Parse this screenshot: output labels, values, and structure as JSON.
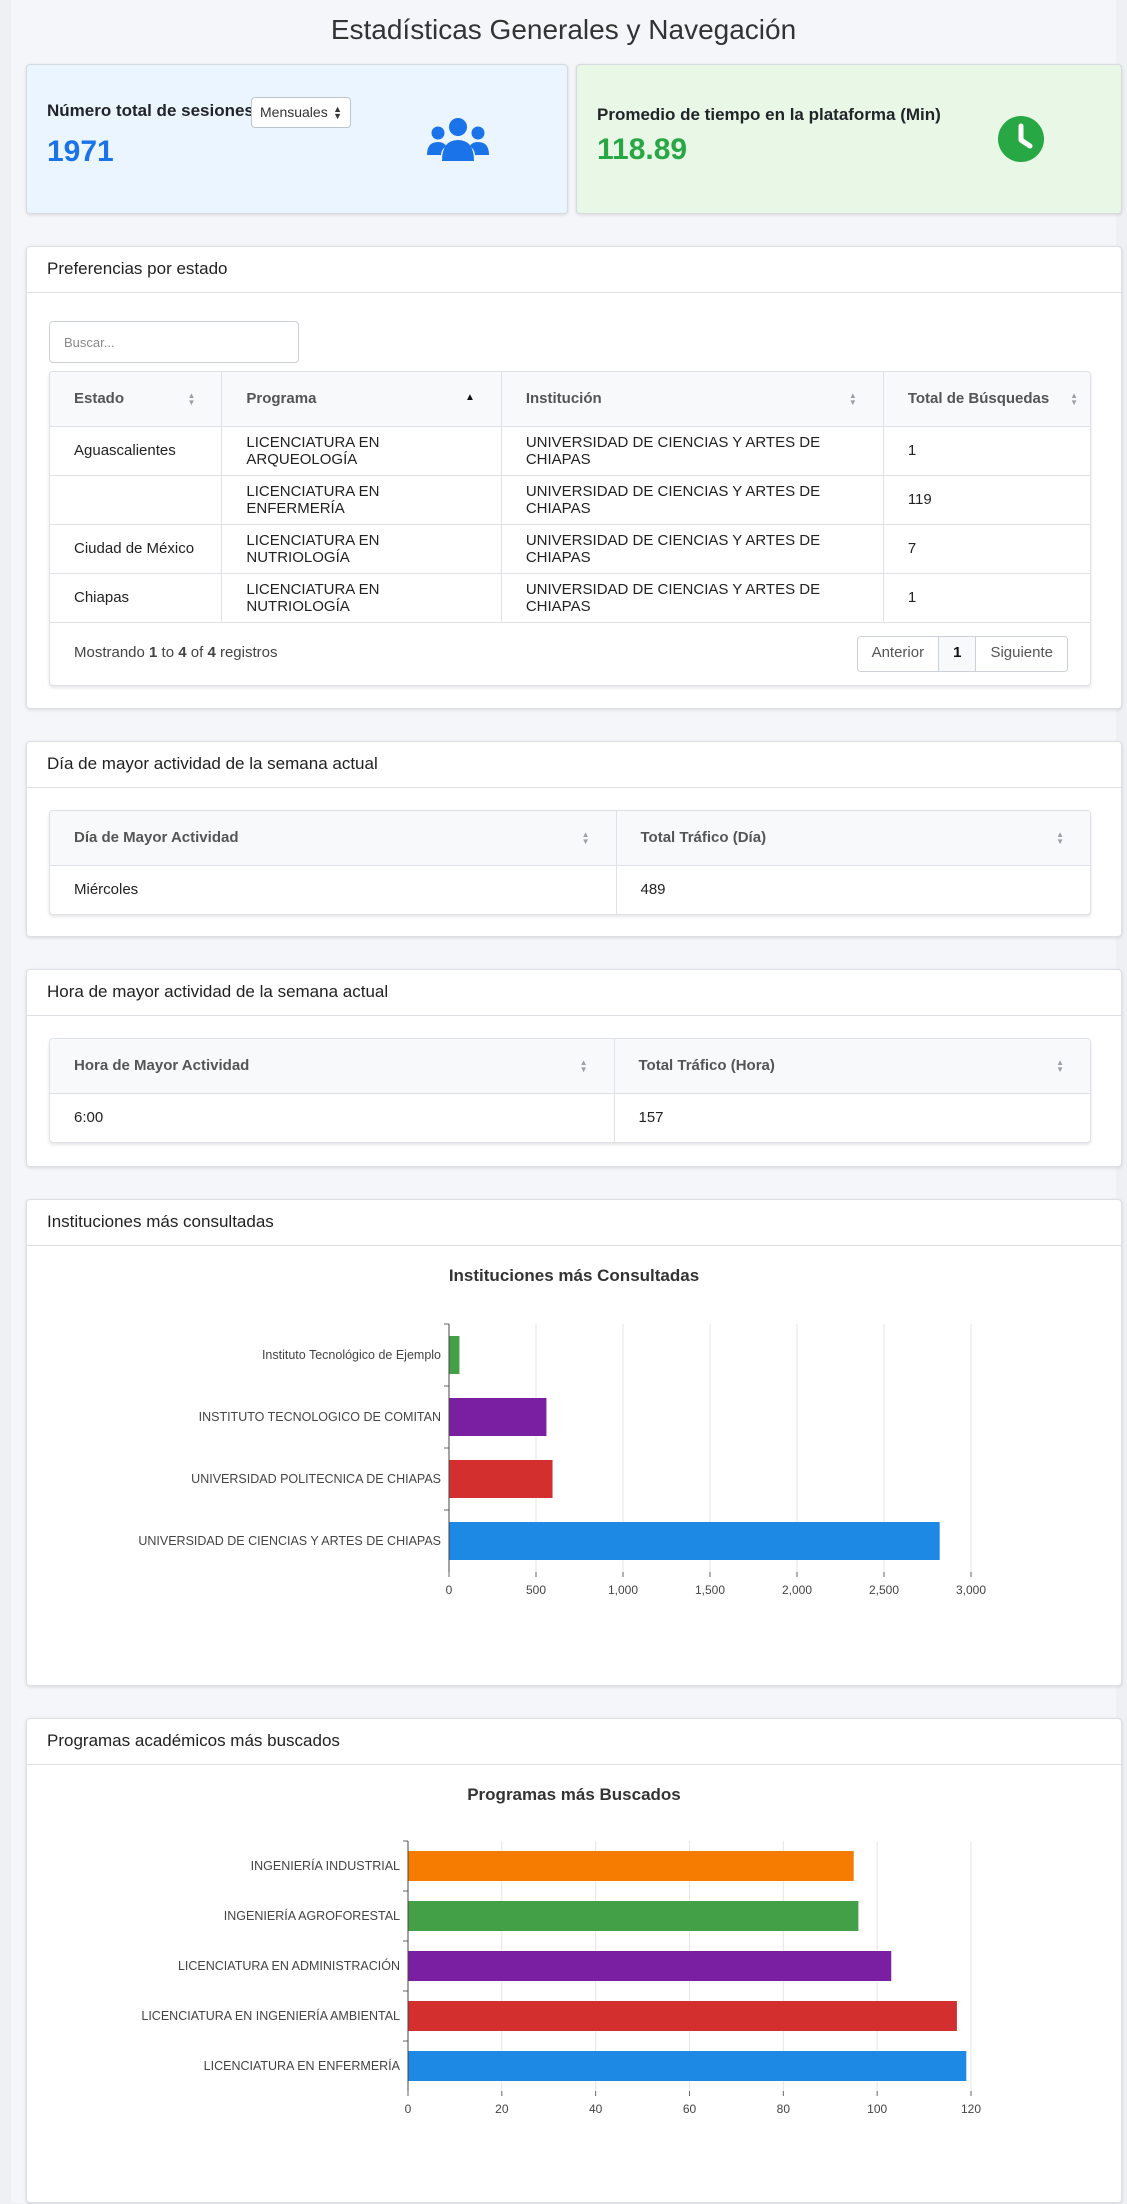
{
  "page": {
    "title": "Estadísticas Generales y Navegación"
  },
  "sessions_card": {
    "label": "Número total de sesiones",
    "select_value": "Mensuales",
    "value": "1971",
    "icon": "users-icon",
    "accent": "#1a73e8"
  },
  "time_card": {
    "label": "Promedio de tiempo en la plataforma (Min)",
    "value": "118.89",
    "icon": "clock-icon",
    "accent": "#28a745"
  },
  "preferences": {
    "title": "Preferencias por estado",
    "search_placeholder": "Buscar...",
    "columns": [
      "Estado",
      "Programa",
      "Institución",
      "Total de Búsquedas"
    ],
    "rows": [
      [
        "Aguascalientes",
        "LICENCIATURA EN ARQUEOLOGÍA",
        "UNIVERSIDAD DE CIENCIAS Y ARTES DE CHIAPAS",
        "1"
      ],
      [
        "",
        "LICENCIATURA EN ENFERMERÍA",
        "UNIVERSIDAD DE CIENCIAS Y ARTES DE CHIAPAS",
        "119"
      ],
      [
        "Ciudad de México",
        "LICENCIATURA EN NUTRIOLOGÍA",
        "UNIVERSIDAD DE CIENCIAS Y ARTES DE CHIAPAS",
        "7"
      ],
      [
        "Chiapas",
        "LICENCIATURA EN NUTRIOLOGÍA",
        "UNIVERSIDAD DE CIENCIAS Y ARTES DE CHIAPAS",
        "1"
      ]
    ],
    "info": {
      "prefix": "Mostrando ",
      "from": "1",
      "to_word": " to ",
      "to": "4",
      "of_word": " of ",
      "total": "4",
      "suffix": " registros"
    },
    "pager": {
      "prev": "Anterior",
      "current": "1",
      "next": "Siguiente"
    }
  },
  "day_activity": {
    "title": "Día de mayor actividad de la semana actual",
    "columns": [
      "Día de Mayor Actividad",
      "Total Tráfico (Día)"
    ],
    "rows": [
      [
        "Miércoles",
        "489"
      ]
    ]
  },
  "hour_activity": {
    "title": "Hora de mayor actividad de la semana actual",
    "columns": [
      "Hora de Mayor Actividad",
      "Total Tráfico (Hora)"
    ],
    "rows": [
      [
        "6:00",
        "157"
      ]
    ]
  },
  "institutions_card": {
    "title": "Instituciones más consultadas"
  },
  "programs_card": {
    "title": "Programas académicos más buscados"
  },
  "chart_data": [
    {
      "type": "bar",
      "orientation": "horizontal",
      "title": "Instituciones más Consultadas",
      "categories": [
        "Instituto Tecnológico de Ejemplo",
        "INSTITUTO TECNOLOGICO DE COMITAN",
        "UNIVERSIDAD POLITECNICA DE CHIAPAS",
        "UNIVERSIDAD DE CIENCIAS Y ARTES DE CHIAPAS"
      ],
      "values": [
        60,
        560,
        595,
        2820
      ],
      "colors": [
        "#43a047",
        "#7b1fa2",
        "#d32f2f",
        "#1e88e5"
      ],
      "xlim": [
        0,
        3000
      ],
      "ticks": [
        "0",
        "500",
        "1,000",
        "1,500",
        "2,000",
        "2,500",
        "3,000"
      ],
      "grid": true
    },
    {
      "type": "bar",
      "orientation": "horizontal",
      "title": "Programas más Buscados",
      "categories": [
        "INGENIERÍA INDUSTRIAL",
        "INGENIERÍA AGROFORESTAL",
        "LICENCIATURA EN ADMINISTRACIÓN",
        "LICENCIATURA EN INGENIERÍA AMBIENTAL",
        "LICENCIATURA EN ENFERMERÍA"
      ],
      "values": [
        95,
        96,
        103,
        117,
        119
      ],
      "colors": [
        "#f57c00",
        "#43a047",
        "#7b1fa2",
        "#d32f2f",
        "#1e88e5"
      ],
      "xlim": [
        0,
        120
      ],
      "ticks": [
        "0",
        "20",
        "40",
        "60",
        "80",
        "100",
        "120"
      ],
      "grid": true
    }
  ]
}
